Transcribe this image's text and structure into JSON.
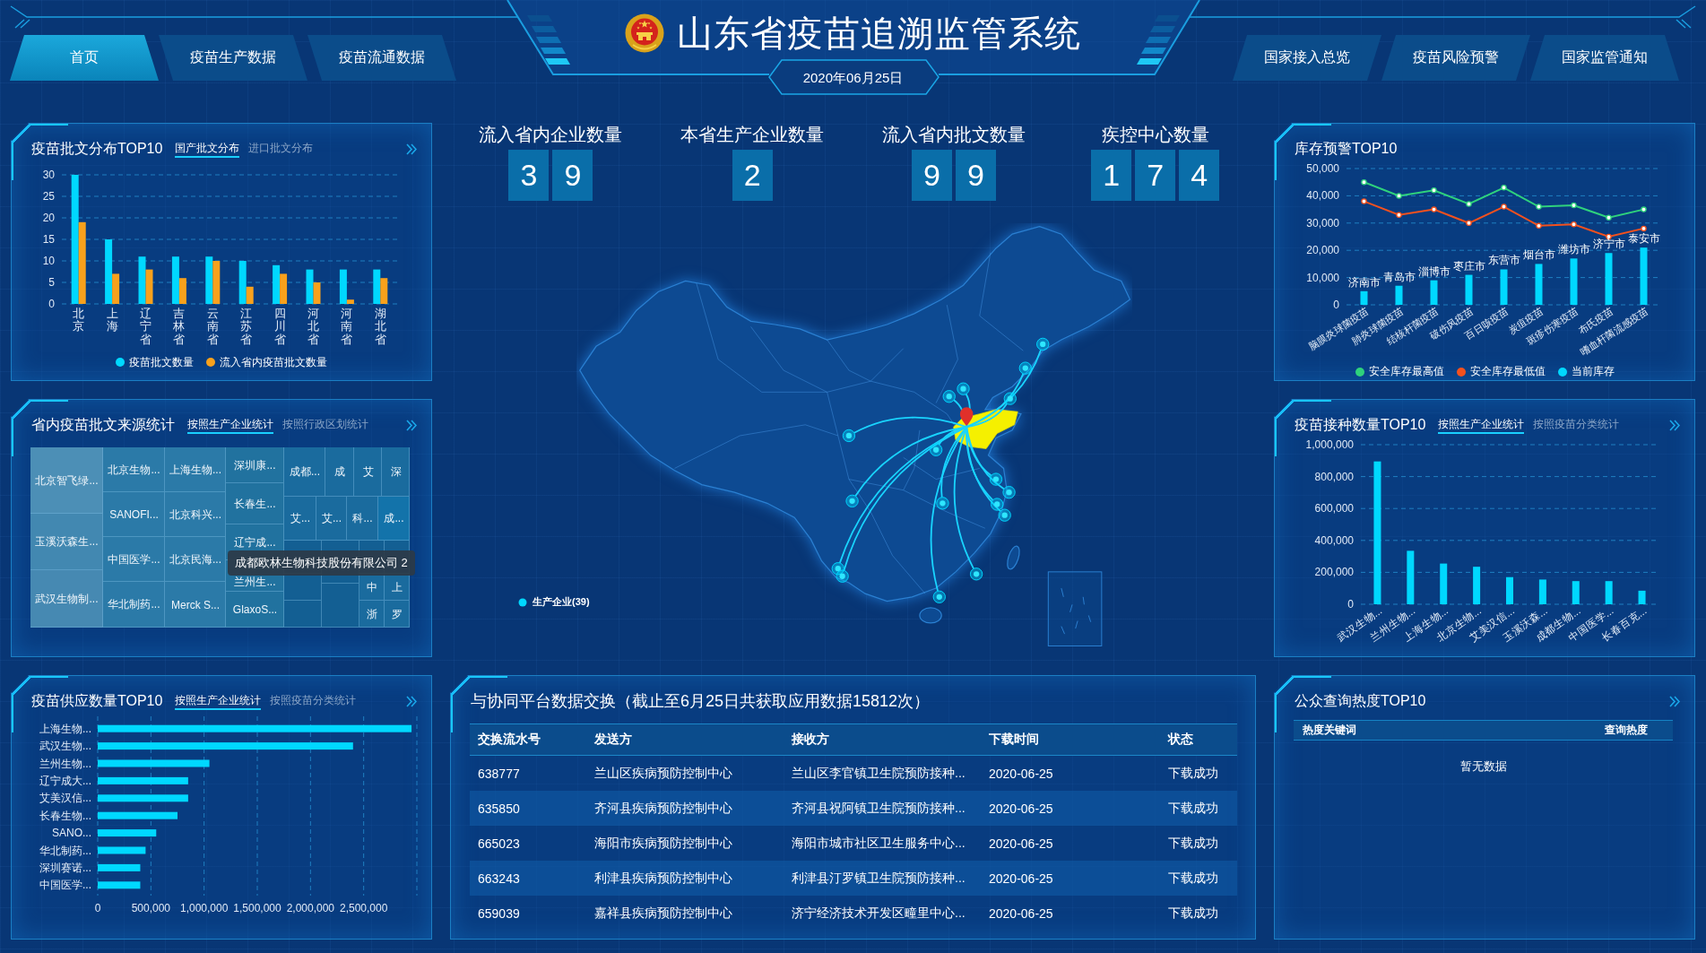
{
  "header": {
    "title": "山东省疫苗追溯监管系统",
    "date": "2020年06月25日",
    "nav_left": [
      {
        "label": "首页",
        "selected": true
      },
      {
        "label": "疫苗生产数据",
        "selected": false
      },
      {
        "label": "疫苗流通数据",
        "selected": false
      }
    ],
    "nav_right": [
      {
        "label": "国家接入总览",
        "selected": false
      },
      {
        "label": "疫苗风险预警",
        "selected": false
      },
      {
        "label": "国家监管通知",
        "selected": false
      }
    ]
  },
  "batch_distribution": {
    "title": "疫苗批文分布TOP10",
    "tabs": [
      {
        "label": "国产批文分布",
        "selected": true
      },
      {
        "label": "进口批文分布",
        "selected": false
      }
    ],
    "chart_data": {
      "type": "bar",
      "categories": [
        "北京",
        "上海",
        "辽宁省",
        "吉林省",
        "云南省",
        "江苏省",
        "四川省",
        "河北省",
        "河南省",
        "湖北省"
      ],
      "series": [
        {
          "name": "疫苗批文数量",
          "color": "#00d8ff",
          "values": [
            30,
            15,
            11,
            11,
            11,
            10,
            9,
            8,
            8,
            8
          ]
        },
        {
          "name": "流入省内疫苗批文数量",
          "color": "#f8a11c",
          "values": [
            19,
            7,
            8,
            6,
            10,
            4,
            7,
            5,
            1,
            6
          ]
        }
      ],
      "ylim": [
        0,
        30
      ],
      "yticks": [
        0,
        5,
        10,
        15,
        20,
        25,
        30
      ],
      "grid": true,
      "legend": true
    }
  },
  "source_statistics": {
    "title": "省内疫苗批文来源统计",
    "tabs": [
      {
        "label": "按照生产企业统计",
        "selected": true
      },
      {
        "label": "按照行政区划统计",
        "selected": false
      }
    ],
    "treemap_tiles": [
      "北京智飞绿...",
      "玉溪沃森生...",
      "武汉生物制...",
      "北京生物...",
      "SANOFI...",
      "中国医学...",
      "华北制药...",
      "上海生物...",
      "北京科兴...",
      "北京民海...",
      "Merck S...",
      "深圳康...",
      "长春生...",
      "辽宁成...",
      "兰州生...",
      "GlaxoS...",
      "成都...",
      "成",
      "艾",
      "深",
      "艾...",
      "艾...",
      "科...",
      "成...",
      "中",
      "上",
      "浙",
      "罗"
    ],
    "tooltip": "成都欧林生物科技股份有限公司 2"
  },
  "supply_top10": {
    "title": "疫苗供应数量TOP10",
    "tabs": [
      {
        "label": "按照生产企业统计",
        "selected": true
      },
      {
        "label": "按照疫苗分类统计",
        "selected": false
      }
    ],
    "chart_data": {
      "type": "bar",
      "orientation": "horizontal",
      "categories": [
        "上海生物...",
        "武汉生物...",
        "兰州生物...",
        "辽宁成大...",
        "艾美汉信...",
        "长春生物...",
        "SANO...",
        "华北制药...",
        "深圳赛诺...",
        "中国医学..."
      ],
      "series": [
        {
          "color": "#00d8ff",
          "values": [
            2950000,
            2400000,
            1050000,
            850000,
            850000,
            750000,
            550000,
            450000,
            400000,
            400000
          ]
        }
      ],
      "xlim": [
        0,
        3000000
      ],
      "xticks": [
        {
          "value": 0,
          "label": "0"
        },
        {
          "value": 500000,
          "label": "500,000"
        },
        {
          "value": 1000000,
          "label": "1,000,000"
        },
        {
          "value": 1500000,
          "label": "1,500,000"
        },
        {
          "value": 2000000,
          "label": "2,000,000"
        },
        {
          "value": 2500000,
          "label": "2,500,000"
        }
      ],
      "grid": true
    }
  },
  "stats": [
    {
      "label": "流入省内企业数量",
      "digits": [
        "3",
        "9"
      ]
    },
    {
      "label": "本省生产企业数量",
      "digits": [
        "2"
      ]
    },
    {
      "label": "流入省内批文数量",
      "digits": [
        "9",
        "9"
      ]
    },
    {
      "label": "疾控中心数量",
      "digits": [
        "1",
        "7",
        "4"
      ]
    }
  ],
  "map": {
    "legend": "生产企业(39)"
  },
  "data_exchange": {
    "title": "与协同平台数据交换（截止至6月25日共获取应用数据15812次）",
    "columns": [
      "交换流水号",
      "发送方",
      "接收方",
      "下载时间",
      "状态"
    ],
    "rows": [
      [
        "638777",
        "兰山区疾病预防控制中心",
        "兰山区李官镇卫生院预防接种...",
        "2020-06-25",
        "下载成功"
      ],
      [
        "635850",
        "齐河县疾病预防控制中心",
        "齐河县祝阿镇卫生院预防接种...",
        "2020-06-25",
        "下载成功"
      ],
      [
        "665023",
        "海阳市疾病预防控制中心",
        "海阳市城市社区卫生服务中心...",
        "2020-06-25",
        "下载成功"
      ],
      [
        "663243",
        "利津县疾病预防控制中心",
        "利津县汀罗镇卫生院预防接种...",
        "2020-06-25",
        "下载成功"
      ],
      [
        "659039",
        "嘉祥县疾病预防控制中心",
        "济宁经济技术开发区疃里中心...",
        "2020-06-25",
        "下载成功"
      ]
    ]
  },
  "inventory_warning": {
    "title": "库存预警TOP10",
    "chart_data": {
      "type": "bar",
      "categories": [
        "脑膜炎球菌疫苗",
        "肺炎球菌疫苗",
        "结核杆菌疫苗",
        "破伤风疫苗",
        "百日咳疫苗",
        "炭疽疫苗",
        "斑疹伤寒疫苗",
        "布氏疫苗",
        "嗜血杆菌流感疫苗"
      ],
      "series": [
        {
          "name": "安全库存最高值",
          "type": "line",
          "marker": true,
          "color": "#2fd27c",
          "values": [
            45000,
            40000,
            42000,
            37000,
            43000,
            36000,
            36500,
            32000,
            35000
          ]
        },
        {
          "name": "安全库存最低值",
          "type": "line",
          "marker": true,
          "color": "#f4511e",
          "values": [
            38000,
            33000,
            35000,
            30000,
            36000,
            29000,
            29500,
            25000,
            28000
          ]
        },
        {
          "name": "当前库存",
          "type": "bar",
          "color": "#00d8ff",
          "values": [
            5000,
            7000,
            9000,
            11000,
            13000,
            15000,
            17000,
            19000,
            21000
          ]
        }
      ],
      "value_labels": [
        "济南市",
        "青岛市",
        "淄博市",
        "枣庄市",
        "东营市",
        "烟台市",
        "潍坊市",
        "济宁市",
        "泰安市"
      ],
      "ylim": [
        0,
        50000
      ],
      "yticks": [
        {
          "value": 0,
          "label": "0"
        },
        {
          "value": 10000,
          "label": "10,000"
        },
        {
          "value": 20000,
          "label": "20,000"
        },
        {
          "value": 30000,
          "label": "30,000"
        },
        {
          "value": 40000,
          "label": "40,000"
        },
        {
          "value": 50000,
          "label": "50,000"
        }
      ],
      "grid": true,
      "legend": true
    }
  },
  "vaccination_top10": {
    "title": "疫苗接种数量TOP10",
    "tabs": [
      {
        "label": "按照生产企业统计",
        "selected": true
      },
      {
        "label": "按照疫苗分类统计",
        "selected": false
      }
    ],
    "chart_data": {
      "type": "bar",
      "categories": [
        "武汉生物...",
        "兰州生物...",
        "上海生物...",
        "北京生物...",
        "艾美汉信...",
        "玉溪沃森...",
        "成都生物...",
        "中国医学...",
        "长春百克..."
      ],
      "series": [
        {
          "color": "#00d8ff",
          "values": [
            895000,
            335000,
            255000,
            235000,
            170000,
            155000,
            145000,
            145000,
            85000
          ]
        }
      ],
      "ylim": [
        0,
        1000000
      ],
      "yticks": [
        {
          "value": 0,
          "label": "0"
        },
        {
          "value": 200000,
          "label": "200,000"
        },
        {
          "value": 400000,
          "label": "400,000"
        },
        {
          "value": 600000,
          "label": "600,000"
        },
        {
          "value": 800000,
          "label": "800,000"
        },
        {
          "value": 1000000,
          "label": "1,000,000"
        }
      ],
      "grid": true
    }
  },
  "public_query": {
    "title": "公众查询热度TOP10",
    "columns": [
      "热度关键词",
      "查询热度"
    ],
    "empty_text": "暂无数据"
  }
}
